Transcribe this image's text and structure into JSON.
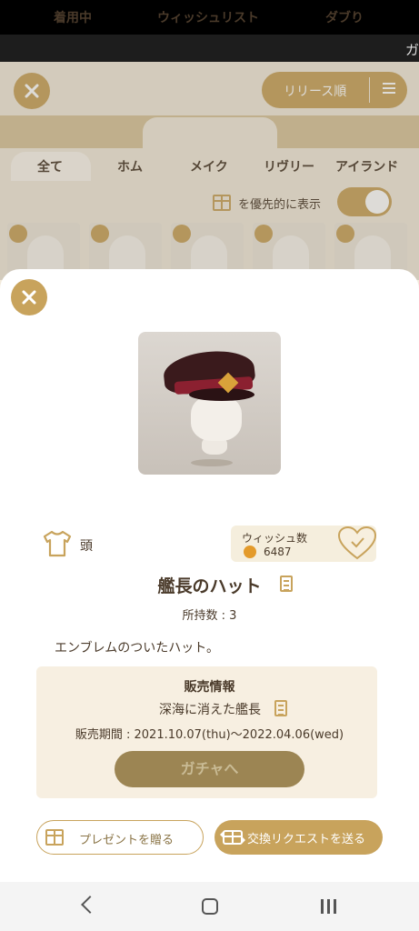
{
  "app": {
    "top_bar_text": "ガ"
  },
  "background": {
    "sort_label": "リリース順",
    "main_tabs": [
      "着用中",
      "ウィッシュリスト",
      "ダブり"
    ],
    "category_tabs": [
      "全て",
      "ホム",
      "メイク",
      "リヴリー",
      "アイランド"
    ],
    "priority_label": "を優先的に表示"
  },
  "item": {
    "category": "頭",
    "wish_title": "ウィッシュ数",
    "wish_count": "6487",
    "name": "艦長のハット",
    "owned": "所持数 : 3",
    "description": "エンブレムのついたハット。"
  },
  "sale": {
    "title": "販売情報",
    "gacha_name": "深海に消えた艦長",
    "period": "販売期間 : 2021.10.07(thu)〜2022.04.06(wed)",
    "gacha_button": "ガチャへ"
  },
  "actions": {
    "present": "プレゼントを贈る",
    "exchange": "交換リクエストを送る"
  },
  "colors": {
    "accent": "#c8a35c",
    "gacha_button": "#9c8553"
  }
}
